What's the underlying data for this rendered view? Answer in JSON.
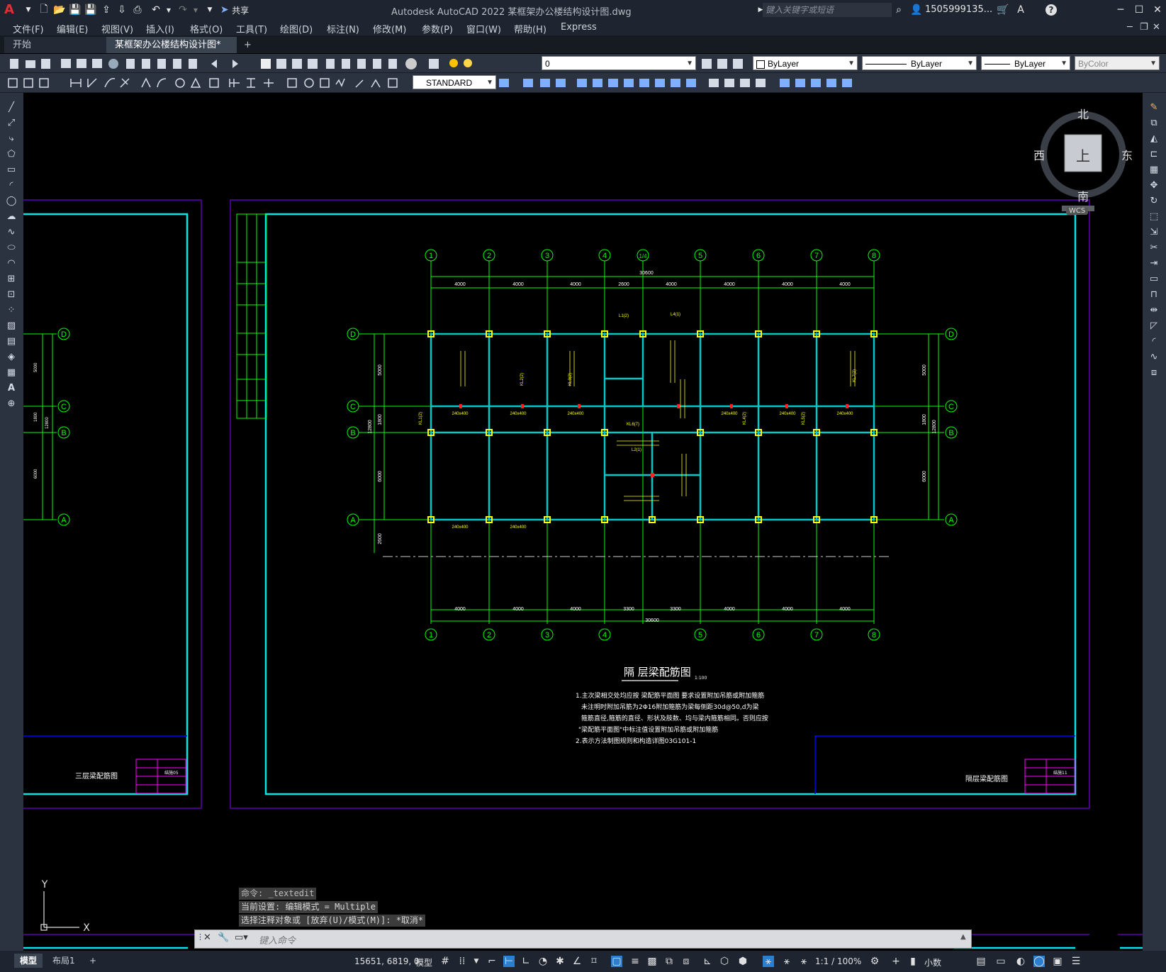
{
  "window": {
    "title": "Autodesk AutoCAD 2022    某框架办公楼结构设计图.dwg",
    "share_label": "共享",
    "search_placeholder": "键入关键字或短语",
    "user": "1505999135...",
    "icons": [
      "new-icon",
      "open-icon",
      "save-icon",
      "saveas-icon",
      "plot-icon",
      "undo-icon",
      "redo-icon",
      "share-icon"
    ]
  },
  "menu": [
    "文件(F)",
    "编辑(E)",
    "视图(V)",
    "插入(I)",
    "格式(O)",
    "工具(T)",
    "绘图(D)",
    "标注(N)",
    "修改(M)",
    "参数(P)",
    "窗口(W)",
    "帮助(H)",
    "Express"
  ],
  "tabs": {
    "start": "开始",
    "active": "某框架办公楼结构设计图*",
    "add": "+"
  },
  "toolbar": {
    "layer_value": "0",
    "color_value": "ByLayer",
    "linetype_value": "ByLayer",
    "lineweight_value": "ByLayer",
    "plotstyle_value": "ByColor",
    "textstyle_value": "STANDARD"
  },
  "viewcube": {
    "north": "北",
    "south": "南",
    "east": "东",
    "west": "西",
    "top": "上",
    "wcs": "WCS"
  },
  "drawing": {
    "left_sheet_title": "三层梁配筋图",
    "right_sheet_title": "隔层梁配筋图",
    "left_sheet_no": "结施05",
    "right_sheet_no": "结施11",
    "plan_title": "隔 层梁配筋图",
    "plan_scale": "1:100",
    "notes": [
      "1.主次梁相交处均应按 梁配筋平面图 要求设置附加吊筋或附加箍筋",
      "未注明时附加吊筋为2Φ16附加箍筋为梁每侧距30d@50,d为梁",
      "箍筋直径,箍筋的直径、形状及肢数、均与梁内箍筋相同。否则应按",
      "\"梁配筋平面图\"中标注值设置附加吊筋或附加箍筋",
      "2.表示方法制图规则和构造详图03G101-1"
    ],
    "axes_top": [
      "1",
      "2",
      "3",
      "4",
      "1/4",
      "5",
      "6",
      "7",
      "8"
    ],
    "axes_bottom": [
      "1",
      "2",
      "3",
      "4",
      "5",
      "6",
      "7",
      "8"
    ],
    "axes_rows": [
      "D",
      "C",
      "B",
      "A"
    ],
    "top_dims": [
      "4000",
      "4000",
      "4000",
      "2600",
      "4000",
      "4000",
      "4000",
      "4000"
    ],
    "top_total": "30600",
    "bottom_dims": [
      "4000",
      "4000",
      "4000",
      "3300",
      "3300",
      "4000",
      "4000",
      "4000"
    ],
    "bottom_total": "30600",
    "row_dims": [
      "5000",
      "1800",
      "6000"
    ],
    "row_total": "12800",
    "left_row_dims": [
      "5000",
      "1800",
      "6000"
    ],
    "left_row_total": "12800",
    "extra_dim": "2600",
    "beam_labels": [
      "240x400",
      "240x400",
      "240x400",
      "240x400",
      "240x400",
      "240x400",
      "240x400",
      "240x400"
    ],
    "beam_marks": [
      "KL1(2)",
      "KL2(2)",
      "KL3(2)",
      "KL4(2)",
      "KL5(2)",
      "KL6(7)",
      "KL7(2)",
      "L1(2)",
      "L2(1)",
      "L4(1)"
    ]
  },
  "command": {
    "history": [
      "命令: _textedit",
      "当前设置: 编辑模式 = Multiple",
      "选择注释对象或 [放弃(U)/模式(M)]: *取消*"
    ],
    "placeholder": "键入命令"
  },
  "status": {
    "model_tab": "模型",
    "layout_tab": "布局1",
    "add": "+",
    "coords": "15651, 6819, 0",
    "space": "模型",
    "scale": "1:1 / 100%",
    "units": "小数"
  },
  "ucs": {
    "x": "X",
    "y": "Y"
  },
  "colors": {
    "sheet_border": "#00e5e5",
    "outer_border": "#5a00b4",
    "grid_green": "#00ff00",
    "beam_cyan": "#00c8c8",
    "column_yellow": "#ffff00",
    "text_white": "#ffffff",
    "rebar_yellow": "#ffff00",
    "magenta": "#ff00ff"
  }
}
